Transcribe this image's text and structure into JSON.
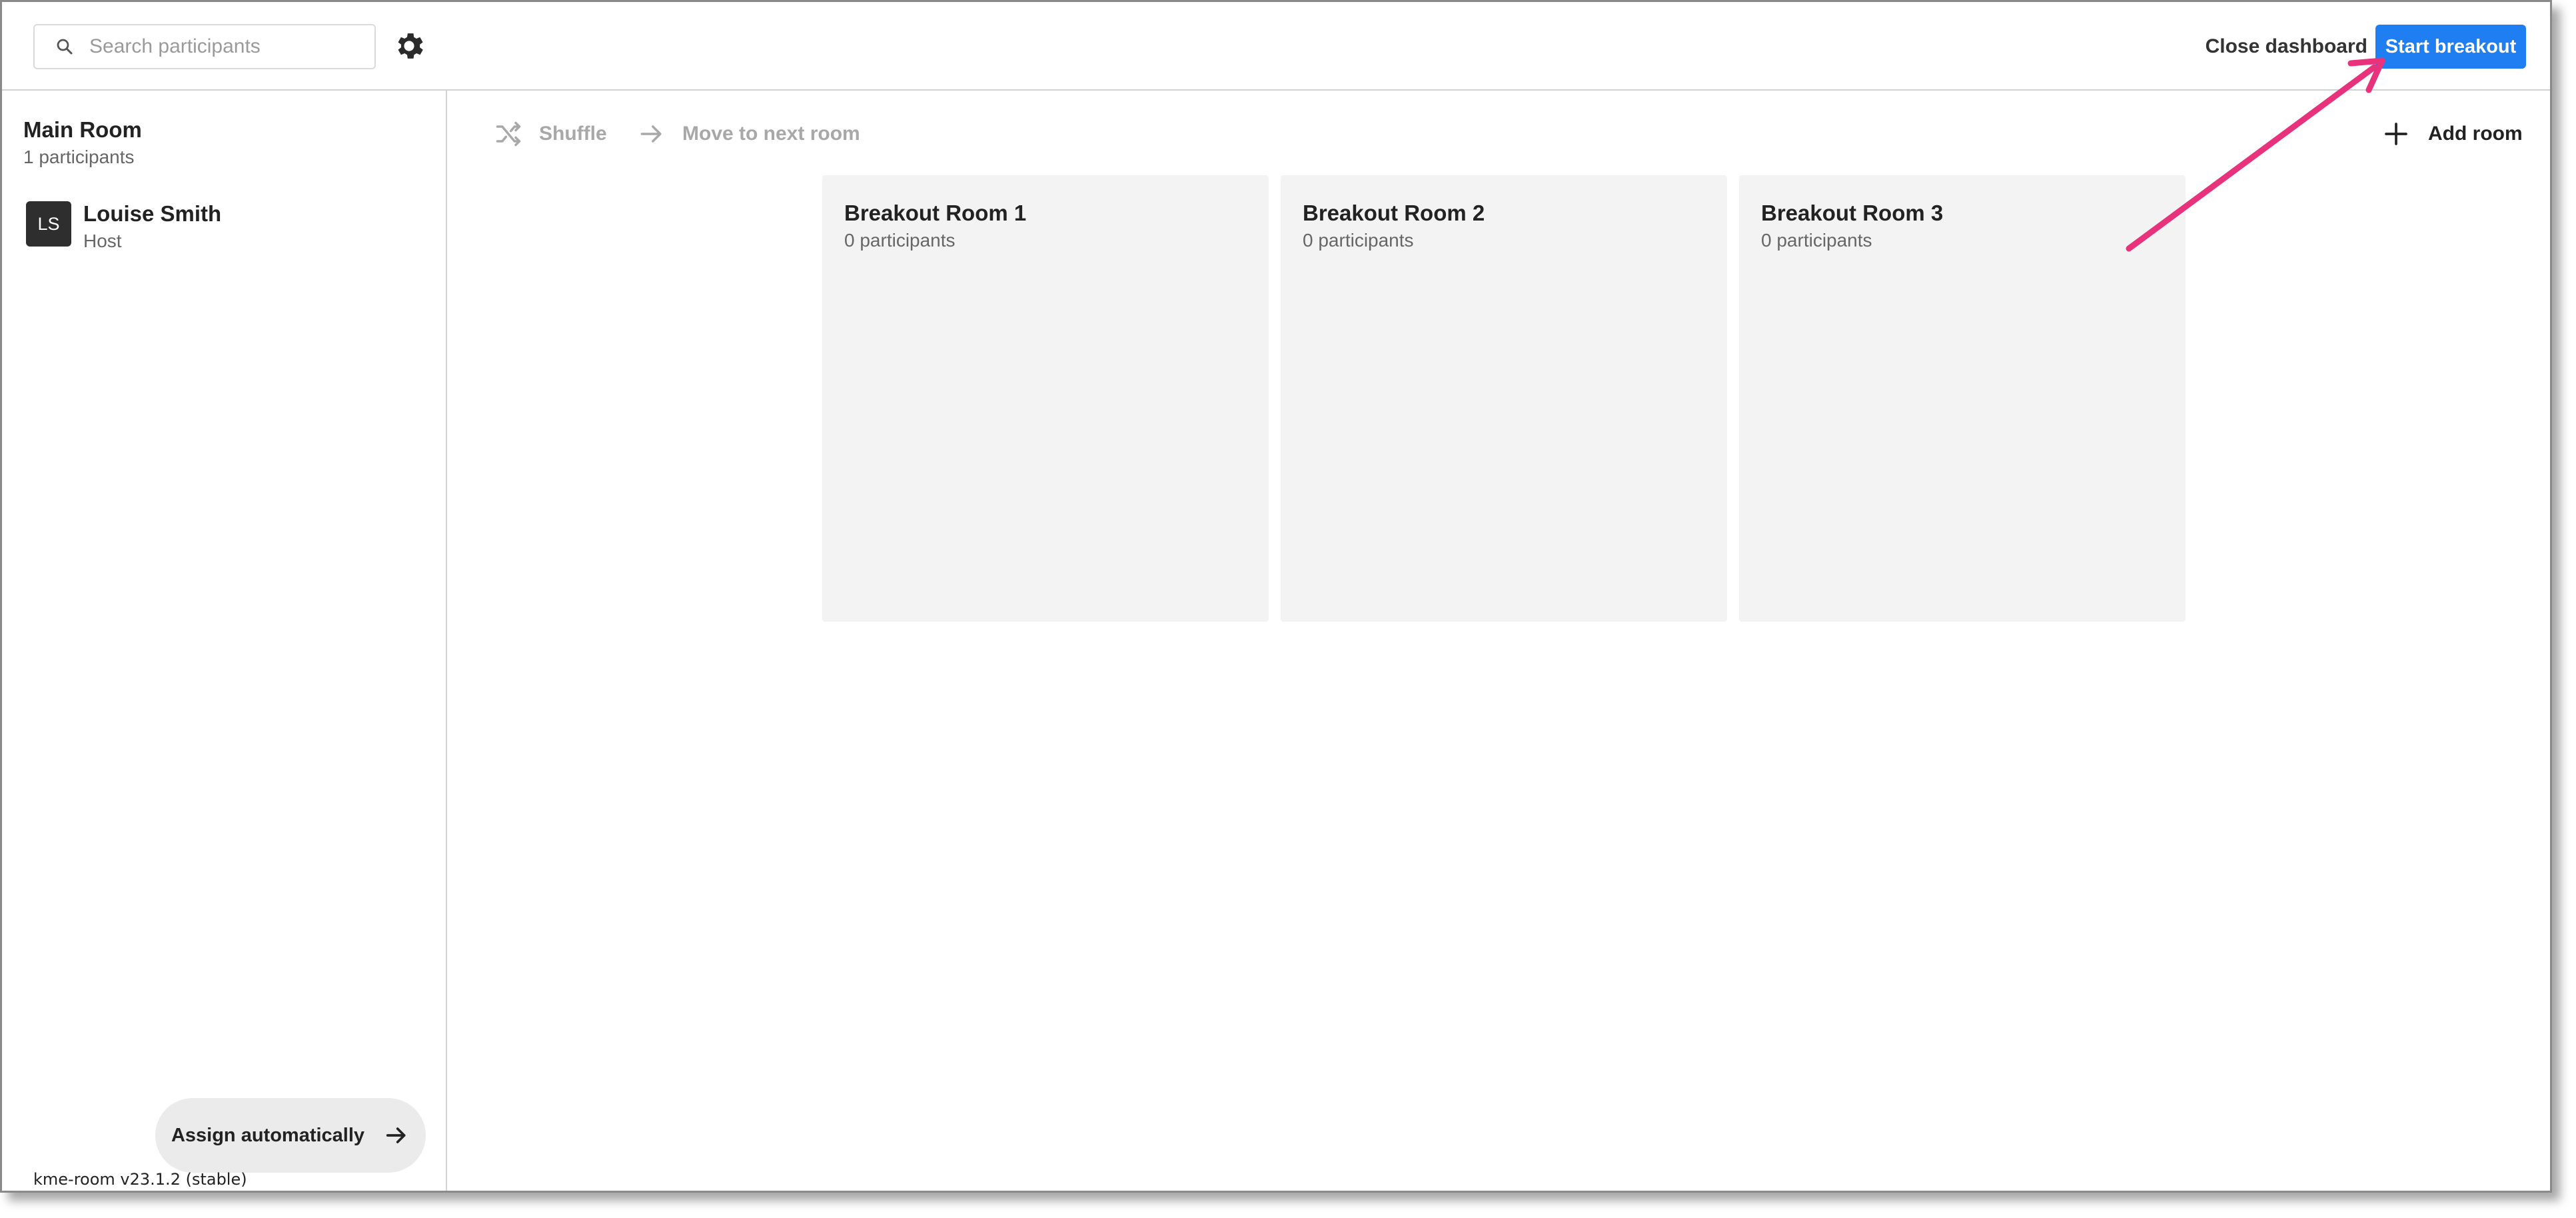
{
  "search": {
    "placeholder": "Search participants"
  },
  "header": {
    "close_label": "Close dashboard",
    "start_label": "Start breakout",
    "accent_color": "#1f7ef2"
  },
  "sidebar": {
    "main_room_title": "Main Room",
    "main_room_count": "1 participants",
    "participant": {
      "initials": "LS",
      "name": "Louise Smith",
      "role": "Host"
    },
    "assign_label": "Assign automatically",
    "version": "kme-room v23.1.2 (stable)"
  },
  "toolbar": {
    "shuffle_label": "Shuffle",
    "move_label": "Move to next room",
    "add_room_label": "Add room"
  },
  "rooms": [
    {
      "title": "Breakout Room 1",
      "count": "0 participants"
    },
    {
      "title": "Breakout Room 2",
      "count": "0 participants"
    },
    {
      "title": "Breakout Room 3",
      "count": "0 participants"
    }
  ],
  "annotation": {
    "color": "#e8327c",
    "icon": "pointer-arrow"
  },
  "icons": [
    "search-icon",
    "gear-icon",
    "shuffle-icon",
    "arrow-right-icon",
    "plus-icon"
  ]
}
